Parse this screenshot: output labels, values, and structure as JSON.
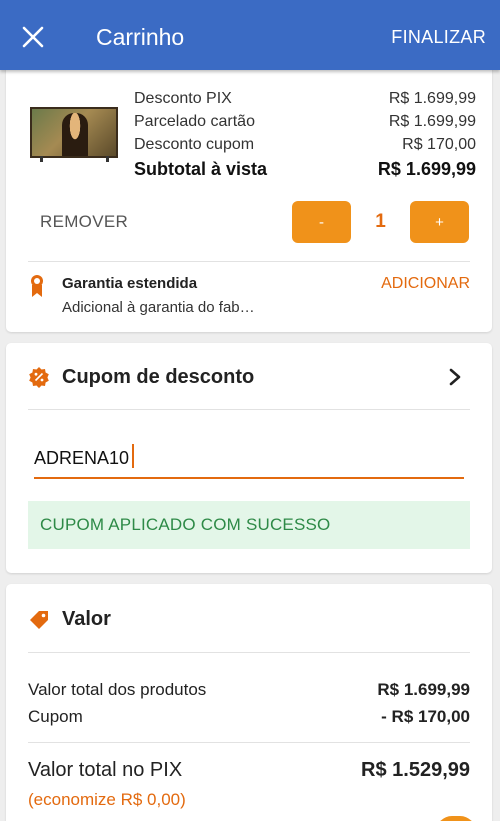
{
  "appbar": {
    "title": "Carrinho",
    "finalize_label": "FINALIZAR",
    "color": "#3b6bc4"
  },
  "product": {
    "image": "mona-lisa-tv-thumbnail",
    "prices": [
      {
        "label": "Desconto PIX",
        "value": "R$ 1.699,99"
      },
      {
        "label": "Parcelado cartão",
        "value": "R$ 1.699,99"
      },
      {
        "label": "Desconto cupom",
        "value": "R$ 170,00"
      }
    ],
    "subtotal": {
      "label": "Subtotal à vista",
      "value": "R$ 1.699,99"
    },
    "remove_label": "REMOVER",
    "minus_label": "-",
    "plus_label": "+",
    "quantity": "1"
  },
  "warranty": {
    "title": "Garantia estendida",
    "description": "Adicional à garantia do fab…",
    "add_label": "ADICIONAR"
  },
  "coupon": {
    "title": "Cupom de desconto",
    "input_value": "ADRENA10",
    "success_message": "CUPOM APLICADO COM SUCESSO"
  },
  "summary": {
    "title": "Valor",
    "rows": [
      {
        "label": "Valor total dos produtos",
        "value": "R$ 1.699,99"
      },
      {
        "label": "Cupom",
        "value": "- R$ 170,00"
      }
    ],
    "total": {
      "label": "Valor total no PIX",
      "value": "R$ 1.529,99"
    },
    "savings": "(economize R$ 0,00)"
  },
  "colors": {
    "accent": "#f0921a",
    "accent_text": "#e36a0f",
    "success_bg": "#e3f6e8",
    "success_text": "#2e8a47"
  }
}
